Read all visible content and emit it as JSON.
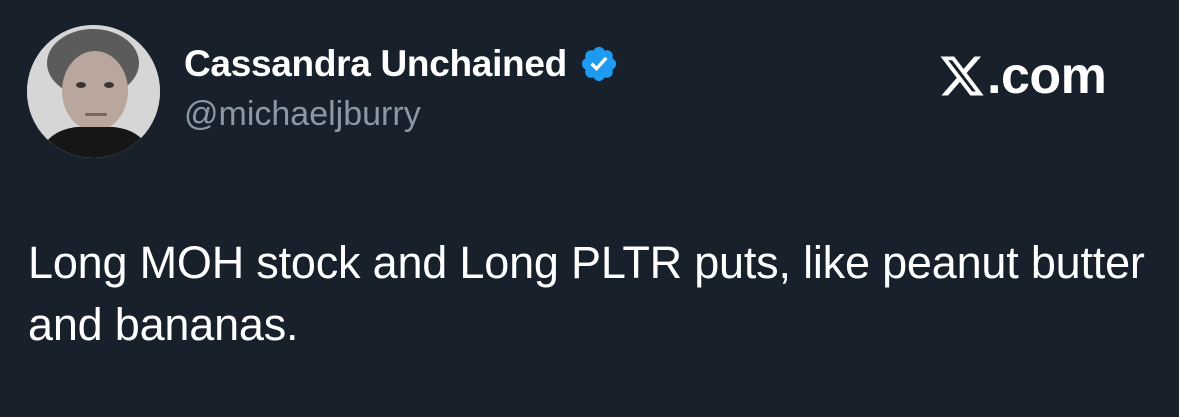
{
  "tweet": {
    "author": {
      "display_name": "Cassandra Unchained",
      "handle": "@michaeljburry",
      "verified": true,
      "verified_icon": "verified-badge-icon",
      "avatar_icon": "user-avatar"
    },
    "brand": {
      "logo_icon": "x-logo-icon",
      "text": ".com"
    },
    "text": "Long MOH stock and Long PLTR puts, like peanut butter and bananas."
  },
  "colors": {
    "background": "#17202b",
    "text_primary": "#ffffff",
    "text_secondary": "#8b98a5",
    "verified_blue": "#1d9bf0"
  }
}
